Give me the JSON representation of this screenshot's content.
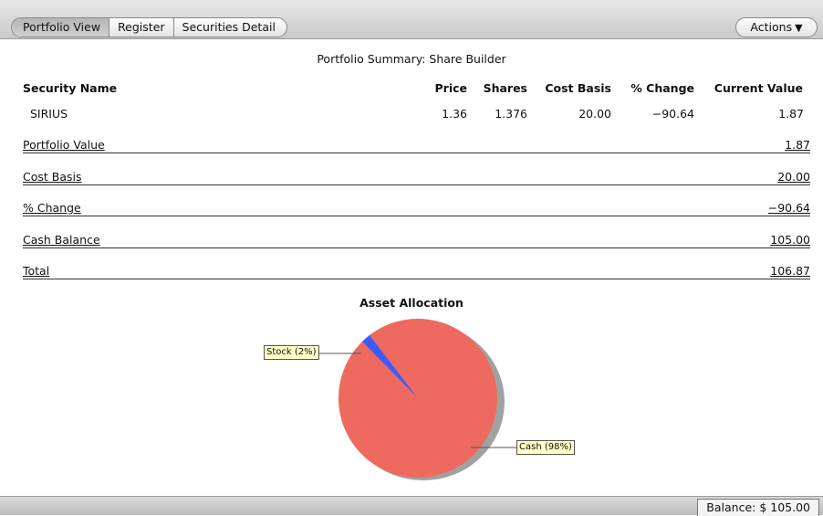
{
  "toolbar": {
    "tabs": [
      "Portfolio View",
      "Register",
      "Securities Detail"
    ],
    "actions_label": "Actions",
    "actions_arrow": "▼"
  },
  "summary_title": "Portfolio Summary: Share Builder",
  "columns": {
    "name": "Security Name",
    "price": "Price",
    "shares": "Shares",
    "cost_basis": "Cost Basis",
    "change": "% Change",
    "current_value": "Current Value"
  },
  "securities": [
    {
      "name": "SIRIUS",
      "price": "1.36",
      "shares": "1.376",
      "cost_basis": "20.00",
      "change": "−90.64",
      "current_value": "1.87"
    }
  ],
  "summary": [
    {
      "label": "Portfolio Value",
      "value": "1.87"
    },
    {
      "label": "Cost Basis",
      "value": "20.00"
    },
    {
      "label": "% Change",
      "value": "−90.64"
    },
    {
      "label": "Cash Balance",
      "value": "105.00"
    },
    {
      "label": "Total",
      "value": "106.87"
    }
  ],
  "chart_data": {
    "type": "pie",
    "title": "Asset Allocation",
    "labels": [
      "Stock (2%)",
      "Cash (98%)"
    ],
    "values": [
      2,
      98
    ],
    "colors": [
      "#3f5bff",
      "#ee6a5e"
    ]
  },
  "footer": {
    "balance": "Balance: $ 105.00"
  }
}
